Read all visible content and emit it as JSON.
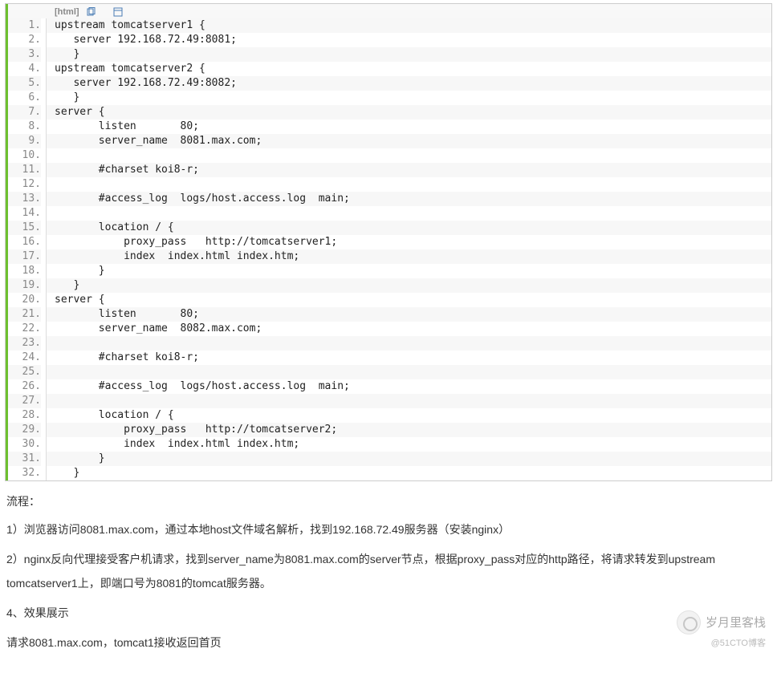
{
  "code": {
    "language_label": "[html]",
    "icons": [
      "copy-icon",
      "view-icon"
    ],
    "lines": [
      "upstream tomcatserver1 {",
      "   server 192.168.72.49:8081;",
      "   }",
      "upstream tomcatserver2 {",
      "   server 192.168.72.49:8082;",
      "   }",
      "server {",
      "       listen       80;",
      "       server_name  8081.max.com;",
      "",
      "       #charset koi8-r;",
      "",
      "       #access_log  logs/host.access.log  main;",
      "",
      "       location / {",
      "           proxy_pass   http://tomcatserver1;",
      "           index  index.html index.htm;",
      "       }",
      "   }",
      "server {",
      "       listen       80;",
      "       server_name  8082.max.com;",
      "",
      "       #charset koi8-r;",
      "",
      "       #access_log  logs/host.access.log  main;",
      "",
      "       location / {",
      "           proxy_pass   http://tomcatserver2;",
      "           index  index.html index.htm;",
      "       }",
      "   }"
    ]
  },
  "article": {
    "p0": "流程：",
    "p1": "1）浏览器访问8081.max.com，通过本地host文件域名解析，找到192.168.72.49服务器（安装nginx）",
    "p2": "2）nginx反向代理接受客户机请求，找到server_name为8081.max.com的server节点，根据proxy_pass对应的http路径，将请求转发到upstream tomcatserver1上，即端口号为8081的tomcat服务器。",
    "p3": "4、效果展示",
    "p4": " 请求8081.max.com，tomcat1接收返回首页"
  },
  "watermark": {
    "brand": "岁月里客栈",
    "sub": "@51CTO博客"
  }
}
